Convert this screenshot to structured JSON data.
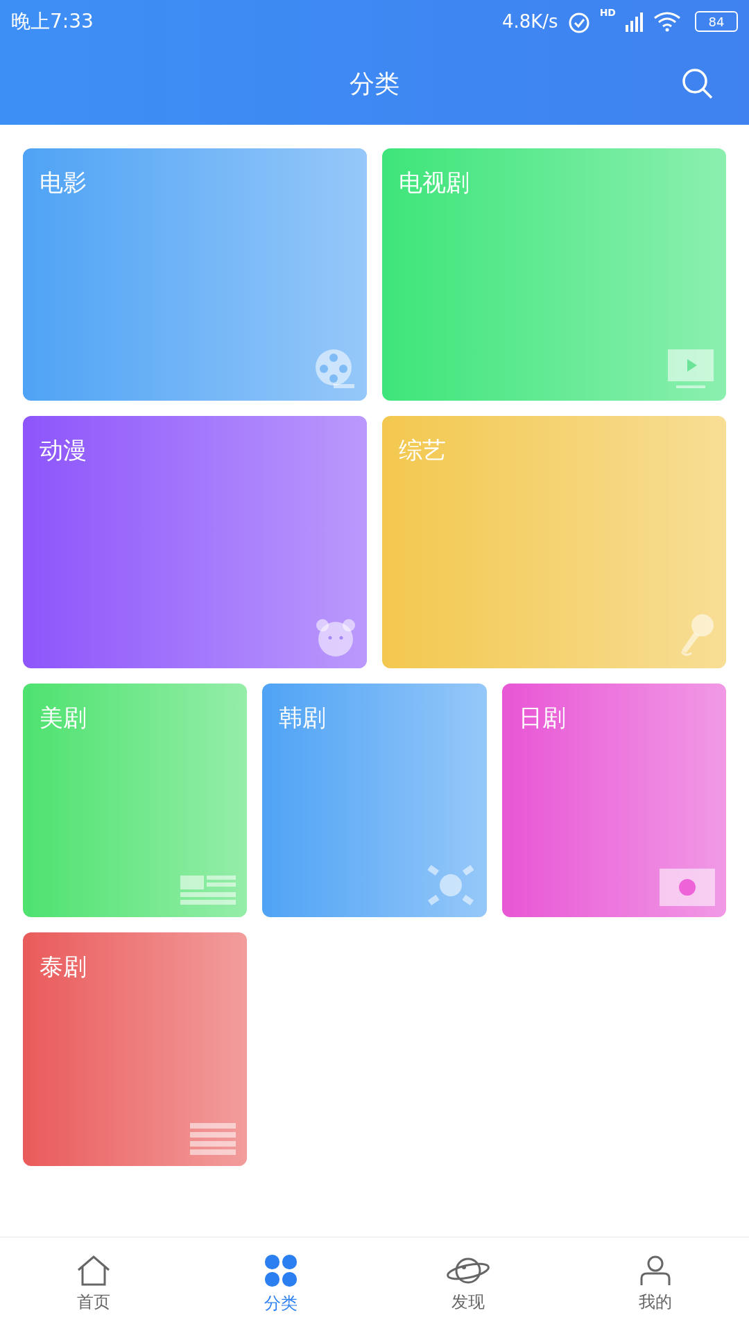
{
  "status_bar": {
    "time": "晚上7:33",
    "speed": "4.8K/s",
    "network": "HD",
    "battery": "84"
  },
  "header": {
    "title": "分类"
  },
  "categories": [
    {
      "name": "电影",
      "kind": "film",
      "color": "#4fa3f5",
      "wide": true
    },
    {
      "name": "电视剧",
      "kind": "tv",
      "color": "#3ee57a",
      "wide": true
    },
    {
      "name": "动漫",
      "kind": "bear",
      "color": "#8d55fb",
      "wide": true
    },
    {
      "name": "综艺",
      "kind": "mic",
      "color": "#f3c84f",
      "wide": true
    },
    {
      "name": "美剧",
      "kind": "us",
      "color": "#4ee26f",
      "wide": false
    },
    {
      "name": "韩剧",
      "kind": "kr",
      "color": "#4fa3f5",
      "wide": false
    },
    {
      "name": "日剧",
      "kind": "jp",
      "color": "#e856d5",
      "wide": false
    },
    {
      "name": "泰剧",
      "kind": "th",
      "color": "#ea5b5b",
      "wide": false
    }
  ],
  "nav": [
    {
      "label": "首页",
      "kind": "home",
      "selected": false
    },
    {
      "label": "分类",
      "kind": "grid",
      "selected": true
    },
    {
      "label": "发现",
      "kind": "planet",
      "selected": false
    },
    {
      "label": "我的",
      "kind": "person",
      "selected": false
    }
  ]
}
